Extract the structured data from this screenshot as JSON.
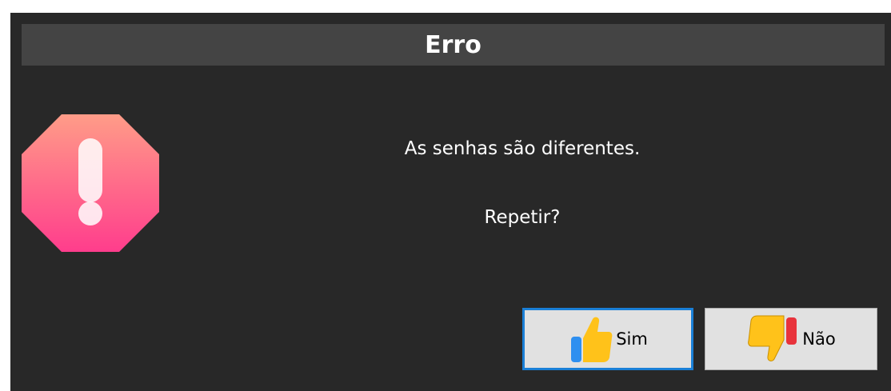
{
  "dialog": {
    "title": "Erro",
    "message": "As senhas são diferentes.",
    "question": "Repetir?",
    "icon": "error-octagon-icon",
    "buttons": {
      "yes_label": "Sim",
      "yes_icon": "thumbs-up-icon",
      "no_label": "Não",
      "no_icon": "thumbs-down-icon"
    }
  },
  "colors": {
    "dialog_bg": "#282828",
    "titlebar_bg": "#444444",
    "text": "#ffffff",
    "button_bg": "#e1e1e1",
    "focus_border": "#1a7fd6",
    "icon_gradient_top": "#ff9a8a",
    "icon_gradient_bottom": "#ff3b8a"
  }
}
